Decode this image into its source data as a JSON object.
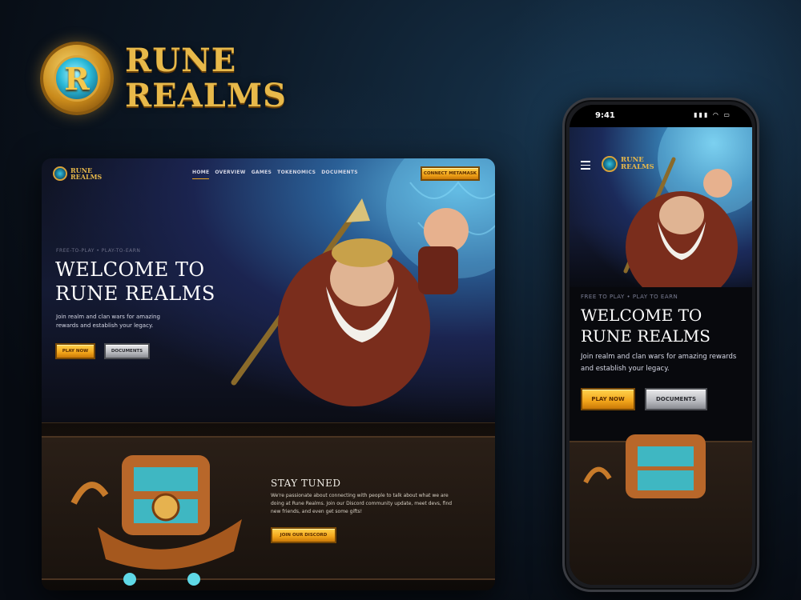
{
  "brand": {
    "line1": "RUNE",
    "line2": "REALMS",
    "emblem_letter": "R"
  },
  "desktop": {
    "logo": {
      "line1": "RUNE",
      "line2": "REALMS"
    },
    "nav": [
      "HOME",
      "OVERVIEW",
      "GAMES",
      "TOKENOMICS",
      "DOCUMENTS"
    ],
    "connect_label": "CONNECT METAMASK",
    "hero": {
      "kicker": "FREE-TO-PLAY • PLAY-TO-EARN",
      "title_line1": "WELCOME TO",
      "title_line2": "RUNE REALMS",
      "subtitle": "Join realm and clan wars for amazing rewards and establish your legacy.",
      "play_label": "PLAY NOW",
      "docs_label": "DOCUMENTS"
    },
    "stay": {
      "title": "STAY TUNED",
      "body": "We're passionate about connecting with people to talk about what we are doing at Rune Realms. Join our Discord community update, meet devs, find new friends, and even get some gifts!",
      "discord_label": "JOIN OUR DISCORD"
    }
  },
  "phone": {
    "time": "9:41",
    "status_icons": "▮▮▮ ◠ ▭",
    "logo": {
      "line1": "RUNE",
      "line2": "REALMS"
    },
    "hero": {
      "kicker": "FREE TO PLAY • PLAY TO EARN",
      "title_line1": "WELCOME TO",
      "title_line2": "RUNE REALMS",
      "subtitle": "Join realm and clan wars for amazing rewards and establish your legacy.",
      "play_label": "PLAY NOW",
      "docs_label": "DOCUMENTS"
    }
  },
  "colors": {
    "gold": "#e8b94a",
    "accent": "#f2a51a",
    "teal": "#2bb9d8"
  }
}
